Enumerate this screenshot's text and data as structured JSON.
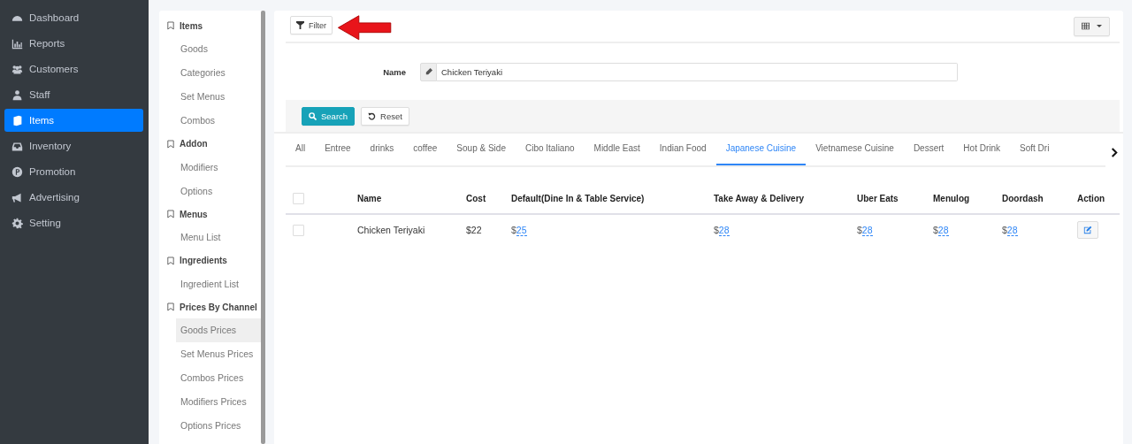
{
  "nav": [
    {
      "label": "Dashboard",
      "selected": false
    },
    {
      "label": "Reports",
      "selected": false
    },
    {
      "label": "Customers",
      "selected": false
    },
    {
      "label": "Staff",
      "selected": false
    },
    {
      "label": "Items",
      "selected": true
    },
    {
      "label": "Inventory",
      "selected": false
    },
    {
      "label": "Promotion",
      "selected": false
    },
    {
      "label": "Advertising",
      "selected": false
    },
    {
      "label": "Setting",
      "selected": false
    }
  ],
  "submenu": [
    {
      "title": "Items",
      "items": [
        {
          "label": "Goods",
          "selected": false
        },
        {
          "label": "Categories",
          "selected": false
        },
        {
          "label": "Set Menus",
          "selected": false
        },
        {
          "label": "Combos",
          "selected": false
        }
      ]
    },
    {
      "title": "Addon",
      "items": [
        {
          "label": "Modifiers",
          "selected": false
        },
        {
          "label": "Options",
          "selected": false
        }
      ]
    },
    {
      "title": "Menus",
      "items": [
        {
          "label": "Menu List",
          "selected": false
        }
      ]
    },
    {
      "title": "Ingredients",
      "items": [
        {
          "label": "Ingredient List",
          "selected": false
        }
      ]
    },
    {
      "title": "Prices By Channel",
      "items": [
        {
          "label": "Goods Prices",
          "selected": true
        },
        {
          "label": "Set Menus Prices",
          "selected": false
        },
        {
          "label": "Combos Prices",
          "selected": false
        },
        {
          "label": "Modifiers Prices",
          "selected": false
        },
        {
          "label": "Options Prices",
          "selected": false
        }
      ]
    }
  ],
  "toolbar": {
    "filter_button": "Filter"
  },
  "filter": {
    "label": "Name",
    "value": "Chicken Teriyaki",
    "search_button": "Search",
    "reset_button": "Reset"
  },
  "tabs": [
    {
      "label": "All",
      "selected": false
    },
    {
      "label": "Entree",
      "selected": false
    },
    {
      "label": "drinks",
      "selected": false
    },
    {
      "label": "coffee",
      "selected": false
    },
    {
      "label": "Soup & Side",
      "selected": false
    },
    {
      "label": "Cibo Italiano",
      "selected": false
    },
    {
      "label": "Middle East",
      "selected": false
    },
    {
      "label": "Indian Food",
      "selected": false
    },
    {
      "label": "Japanese Cuisine",
      "selected": true
    },
    {
      "label": "Vietnamese Cuisine",
      "selected": false
    },
    {
      "label": "Dessert",
      "selected": false
    },
    {
      "label": "Hot Drink",
      "selected": false
    },
    {
      "label": "Soft Dri",
      "selected": false
    }
  ],
  "table": {
    "header_checked": false,
    "columns": [
      "Name",
      "Cost",
      "Default(Dine In & Table Service)",
      "Take Away & Delivery",
      "Uber Eats",
      "Menulog",
      "Doordash",
      "Action"
    ],
    "rows": [
      {
        "checked": false,
        "name": "Chicken Teriyaki",
        "cost": "$22",
        "prices": [
          {
            "currency": "$",
            "value": "25"
          },
          {
            "currency": "$",
            "value": "28"
          },
          {
            "currency": "$",
            "value": "28"
          },
          {
            "currency": "$",
            "value": "28"
          },
          {
            "currency": "$",
            "value": "28"
          }
        ]
      }
    ]
  }
}
